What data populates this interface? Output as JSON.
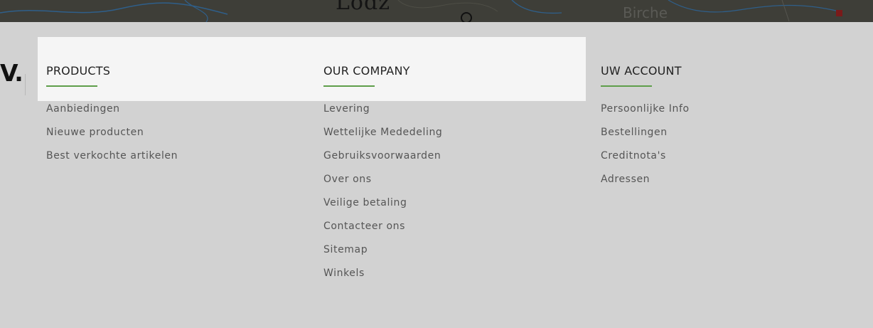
{
  "map": {
    "city_label": "Lodz",
    "town_label": "Birche"
  },
  "brand": {
    "partial_text": "V."
  },
  "columns": {
    "products": {
      "title": "PRODUCTS",
      "links": [
        "Aanbiedingen",
        "Nieuwe producten",
        "Best verkochte artikelen"
      ]
    },
    "company": {
      "title": "OUR COMPANY",
      "links": [
        "Levering",
        "Wettelijke Mededeling",
        "Gebruiksvoorwaarden",
        "Over ons",
        "Veilige betaling",
        "Contacteer ons",
        "Sitemap",
        "Winkels"
      ]
    },
    "account": {
      "title": "UW ACCOUNT",
      "links": [
        "Persoonlijke Info",
        "Bestellingen",
        "Creditnota's",
        "Adressen"
      ]
    }
  },
  "colors": {
    "accent_underline": "#5e9e4a",
    "footer_background": "#d2d2d2",
    "highlight_background": "#f5f5f5",
    "map_background": "#3e3e38"
  }
}
